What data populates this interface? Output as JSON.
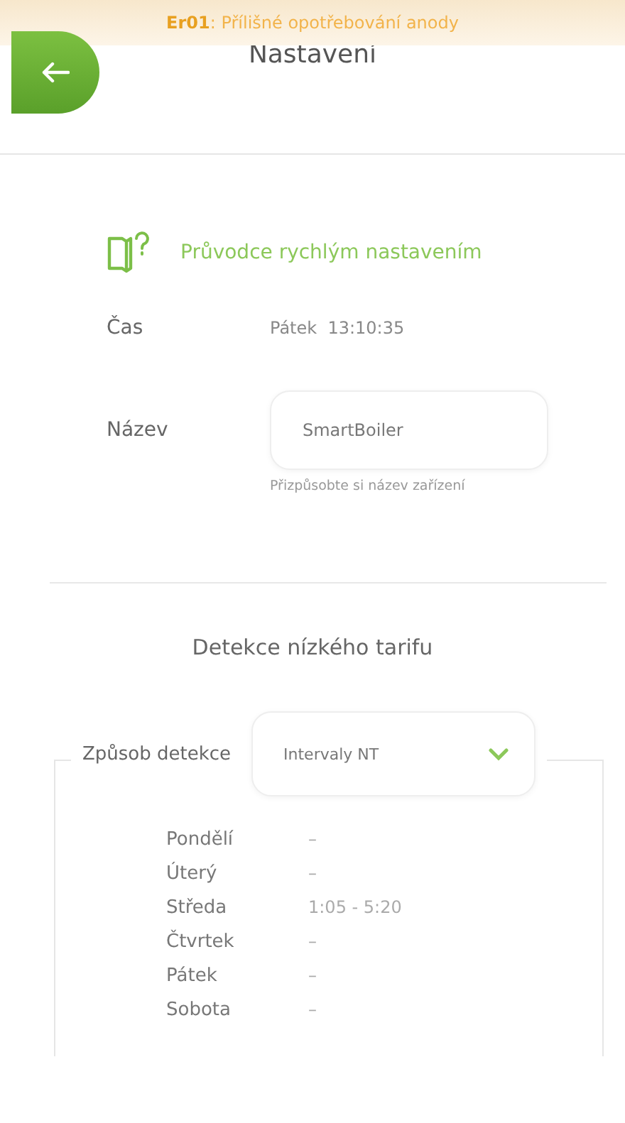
{
  "banner": {
    "text": "**Er01**: Přílišné opotřebování anody"
  },
  "header": {
    "title": "Nastavení"
  },
  "wizard": {
    "label": "Průvodce rychlým nastavením"
  },
  "time": {
    "label": "Čas",
    "value": "Pátek  13:10:35"
  },
  "name": {
    "label": "Název",
    "value": "SmartBoiler",
    "hint": "Přizpůsobte si název zařízení"
  },
  "tariff": {
    "heading": "Detekce nízkého tarifu",
    "method_label": "Způsob detekce",
    "method_value": "Intervaly NT",
    "days": [
      {
        "day": "Pondělí",
        "interval": "–"
      },
      {
        "day": "Úterý",
        "interval": "–"
      },
      {
        "day": "Středa",
        "interval": "1:05 - 5:20"
      },
      {
        "day": "Čtvrtek",
        "interval": "–"
      },
      {
        "day": "Pátek",
        "interval": "–"
      },
      {
        "day": "Sobota",
        "interval": "–"
      }
    ]
  }
}
